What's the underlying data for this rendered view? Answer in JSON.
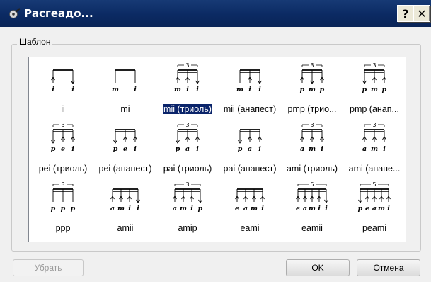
{
  "window": {
    "title": "Расгеадо...",
    "help_label": "?",
    "close_label": "✕"
  },
  "group": {
    "label": "Шаблон"
  },
  "patterns": [
    {
      "label": "ii",
      "notes": [
        "i",
        "i"
      ],
      "tuplet": "",
      "arrows": [
        "up",
        "down"
      ],
      "selected": false
    },
    {
      "label": "mi",
      "notes": [
        "m",
        "i"
      ],
      "tuplet": "",
      "arrows": [
        "",
        ""
      ],
      "selected": false
    },
    {
      "label": "mii (триоль)",
      "notes": [
        "m",
        "i",
        "i"
      ],
      "tuplet": "3",
      "arrows": [
        "up",
        "up",
        "down"
      ],
      "selected": true
    },
    {
      "label": "mii (анапест)",
      "notes": [
        "m",
        "i",
        "i"
      ],
      "tuplet": "",
      "arrows": [
        "",
        "up",
        "down"
      ],
      "selected": false
    },
    {
      "label": "pmp (трио...",
      "notes": [
        "p",
        "m",
        "p"
      ],
      "tuplet": "3",
      "arrows": [
        "up",
        "down",
        "up"
      ],
      "selected": false
    },
    {
      "label": "pmp (анап...",
      "notes": [
        "p",
        "m",
        "p"
      ],
      "tuplet": "3",
      "arrows": [
        "down",
        "up",
        "up"
      ],
      "selected": false
    },
    {
      "label": "pei (триоль)",
      "notes": [
        "p",
        "e",
        "i"
      ],
      "tuplet": "3",
      "arrows": [
        "down",
        "up",
        "up"
      ],
      "selected": false
    },
    {
      "label": "pei (анапест)",
      "notes": [
        "p",
        "e",
        "i"
      ],
      "tuplet": "",
      "arrows": [
        "down",
        "up",
        "up"
      ],
      "selected": false
    },
    {
      "label": "pai (триоль)",
      "notes": [
        "p",
        "a",
        "i"
      ],
      "tuplet": "3",
      "arrows": [
        "down",
        "up",
        "up"
      ],
      "selected": false
    },
    {
      "label": "pai (анапест)",
      "notes": [
        "p",
        "a",
        "i"
      ],
      "tuplet": "",
      "arrows": [
        "down",
        "up",
        "up"
      ],
      "selected": false
    },
    {
      "label": "ami (триоль)",
      "notes": [
        "a",
        "m",
        "i"
      ],
      "tuplet": "3",
      "arrows": [
        "up",
        "up",
        "up"
      ],
      "selected": false
    },
    {
      "label": "ami (анапе...",
      "notes": [
        "a",
        "m",
        "i"
      ],
      "tuplet": "3",
      "arrows": [
        "up",
        "up",
        "up"
      ],
      "selected": false
    },
    {
      "label": "ppp",
      "notes": [
        "p",
        "p",
        "p"
      ],
      "tuplet": "3",
      "arrows": [
        "",
        "",
        ""
      ],
      "selected": false
    },
    {
      "label": "amii",
      "notes": [
        "a",
        "m",
        "i",
        "i"
      ],
      "tuplet": "",
      "arrows": [
        "up",
        "up",
        "up",
        "down"
      ],
      "selected": false
    },
    {
      "label": "amip",
      "notes": [
        "a",
        "m",
        "i",
        "p"
      ],
      "tuplet": "3",
      "arrows": [
        "up",
        "up",
        "up",
        "down"
      ],
      "selected": false
    },
    {
      "label": "eami",
      "notes": [
        "e",
        "a",
        "m",
        "i"
      ],
      "tuplet": "",
      "arrows": [
        "up",
        "up",
        "up",
        "up"
      ],
      "selected": false
    },
    {
      "label": "eamii",
      "notes": [
        "e",
        "a",
        "m",
        "i",
        "i"
      ],
      "tuplet": "5",
      "arrows": [
        "up",
        "up",
        "up",
        "up",
        "down"
      ],
      "selected": false
    },
    {
      "label": "peami",
      "notes": [
        "p",
        "e",
        "a",
        "m",
        "i"
      ],
      "tuplet": "5",
      "arrows": [
        "down",
        "up",
        "up",
        "up",
        "up"
      ],
      "selected": false
    }
  ],
  "buttons": {
    "remove_label": "Убрать",
    "ok_label": "OK",
    "cancel_label": "Отмена"
  }
}
